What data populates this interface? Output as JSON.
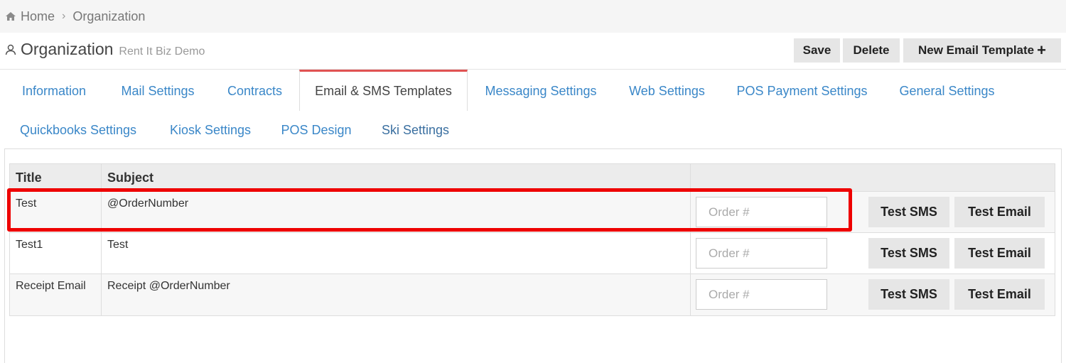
{
  "breadcrumb": {
    "home": "Home",
    "current": "Organization"
  },
  "header": {
    "title": "Organization",
    "subtitle": "Rent It Biz Demo"
  },
  "actions": {
    "save": "Save",
    "delete": "Delete",
    "new_template": "New Email Template",
    "plus": "+"
  },
  "tabs": [
    {
      "label": "Information"
    },
    {
      "label": "Mail Settings"
    },
    {
      "label": "Contracts"
    },
    {
      "label": "Email & SMS Templates"
    },
    {
      "label": "Messaging Settings"
    },
    {
      "label": "Web Settings"
    },
    {
      "label": "POS Payment Settings"
    },
    {
      "label": "General Settings"
    },
    {
      "label": "Quickbooks Settings"
    },
    {
      "label": "Kiosk Settings"
    },
    {
      "label": "POS Design"
    },
    {
      "label": "Ski Settings"
    }
  ],
  "active_tab": "Email & SMS Templates",
  "table": {
    "columns": [
      "Title",
      "Subject",
      ""
    ],
    "rows": [
      {
        "title": "Test",
        "subject": "@OrderNumber",
        "order_placeholder": "Order #",
        "sms_label": "Test SMS",
        "email_label": "Test Email"
      },
      {
        "title": "Test1",
        "subject": "Test",
        "order_placeholder": "Order #",
        "sms_label": "Test SMS",
        "email_label": "Test Email"
      },
      {
        "title": "Receipt Email",
        "subject": "Receipt @OrderNumber",
        "order_placeholder": "Order #",
        "sms_label": "Test SMS",
        "email_label": "Test Email"
      }
    ]
  },
  "colors": {
    "link": "#3a87c8",
    "active_tab_border": "#e05252",
    "highlight": "#ee0000"
  }
}
